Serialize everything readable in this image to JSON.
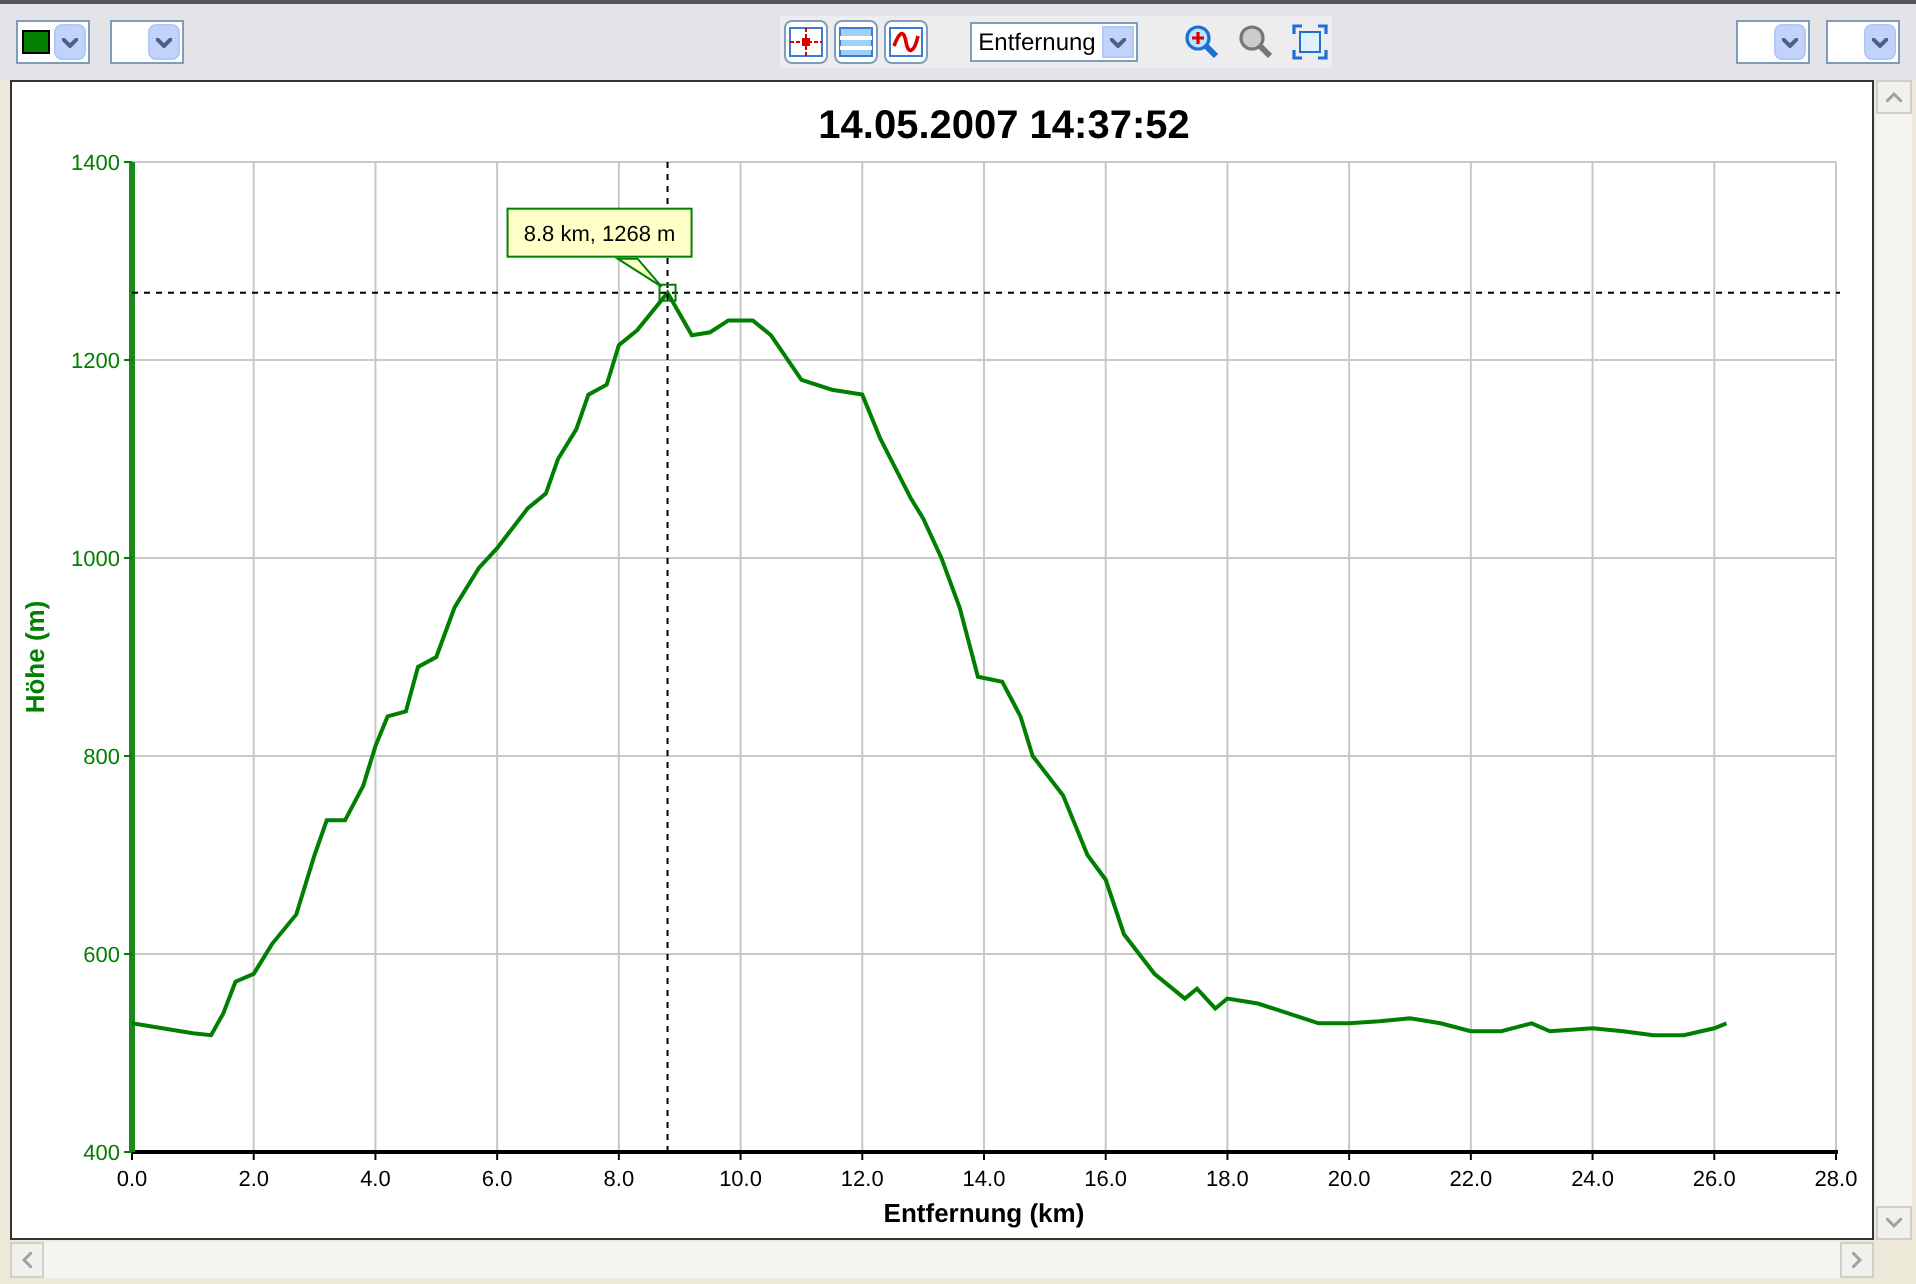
{
  "toolbar": {
    "color_picker": {
      "color": "#007f00"
    },
    "axis_select": {
      "value": "Entfernung"
    }
  },
  "chart": {
    "chart_data": {
      "type": "line",
      "title": "14.05.2007 14:37:52",
      "xlabel": "Entfernung (km)",
      "ylabel": "Höhe (m)",
      "x": [
        0,
        0.5,
        1,
        1.3,
        1.5,
        1.7,
        2,
        2.3,
        2.7,
        3,
        3.2,
        3.5,
        3.8,
        4,
        4.2,
        4.5,
        4.7,
        5,
        5.3,
        5.7,
        6,
        6.5,
        6.8,
        7,
        7.3,
        7.5,
        7.8,
        8,
        8.3,
        8.8,
        9.2,
        9.5,
        9.8,
        10.2,
        10.5,
        11,
        11.5,
        12,
        12.3,
        12.8,
        13,
        13.3,
        13.6,
        13.9,
        14.3,
        14.6,
        14.8,
        15.3,
        15.7,
        16,
        16.3,
        16.8,
        17.3,
        17.5,
        17.8,
        18,
        18.5,
        19,
        19.5,
        20,
        20.5,
        21,
        21.5,
        22,
        22.5,
        23,
        23.3,
        24,
        24.5,
        25,
        25.5,
        26,
        26.2
      ],
      "series": [
        {
          "color": "#007f00",
          "values": [
            530,
            525,
            520,
            518,
            540,
            572,
            580,
            610,
            640,
            700,
            735,
            735,
            770,
            810,
            840,
            845,
            890,
            900,
            950,
            990,
            1010,
            1050,
            1065,
            1100,
            1130,
            1165,
            1175,
            1215,
            1230,
            1268,
            1225,
            1228,
            1240,
            1240,
            1225,
            1180,
            1170,
            1165,
            1120,
            1060,
            1040,
            1000,
            950,
            880,
            875,
            840,
            800,
            760,
            700,
            675,
            620,
            580,
            555,
            565,
            545,
            555,
            550,
            540,
            530,
            530,
            532,
            535,
            530,
            522,
            522,
            530,
            522,
            525,
            522,
            518,
            518,
            525,
            530
          ]
        }
      ],
      "xlim": [
        0,
        28
      ],
      "ylim": [
        400,
        1400
      ],
      "xticks": [
        {
          "value": 0,
          "label": "0.0"
        },
        {
          "value": 2,
          "label": "2.0"
        },
        {
          "value": 4,
          "label": "4.0"
        },
        {
          "value": 6,
          "label": "6.0"
        },
        {
          "value": 8,
          "label": "8.0"
        },
        {
          "value": 10,
          "label": "10.0"
        },
        {
          "value": 12,
          "label": "12.0"
        },
        {
          "value": 14,
          "label": "14.0"
        },
        {
          "value": 16,
          "label": "16.0"
        },
        {
          "value": 18,
          "label": "18.0"
        },
        {
          "value": 20,
          "label": "20.0"
        },
        {
          "value": 22,
          "label": "22.0"
        },
        {
          "value": 24,
          "label": "24.0"
        },
        {
          "value": 26,
          "label": "26.0"
        },
        {
          "value": 28,
          "label": "28.0"
        }
      ],
      "yticks": [
        400,
        600,
        800,
        1000,
        1200,
        1400
      ],
      "grid": true,
      "ref_lines": [
        {
          "axis": "x",
          "value": 8.8
        },
        {
          "axis": "y",
          "value": 1268
        }
      ],
      "annotations": [
        {
          "x": 8.8,
          "y": 1268,
          "text": "8.8 km, 1268 m"
        }
      ]
    }
  }
}
